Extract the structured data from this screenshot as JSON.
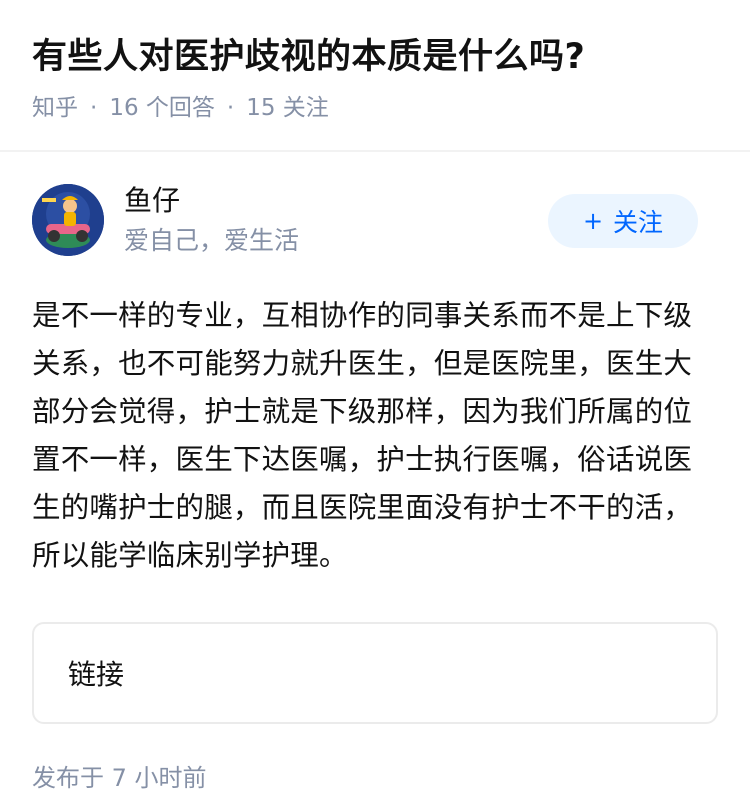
{
  "question": {
    "title": "有些人对医护歧视的本质是什么吗?",
    "source": "知乎",
    "separator": "·",
    "answers": "16 个回答",
    "followers": "15 关注"
  },
  "author": {
    "name": "鱼仔",
    "bio": "爱自己，爱生活",
    "follow_plus": "+",
    "follow_label": "关注"
  },
  "answer": {
    "text": "是不一样的专业，互相协作的同事关系而不是上下级关系，也不可能努力就升医生，但是医院里，医生大部分会觉得，护士就是下级那样，因为我们所属的位置不一样，医生下达医嘱，护士执行医嘱，俗话说医生的嘴护士的腿，而且医院里面没有护士不干的活，所以能学临床别学护理。",
    "link_label": "链接",
    "publish_time": "发布于  7 小时前"
  },
  "colors": {
    "accent": "#0066ff",
    "follow_bg": "#ebf5ff",
    "meta_text": "#8590a6",
    "avatar_bg": "#1f3f8e"
  }
}
